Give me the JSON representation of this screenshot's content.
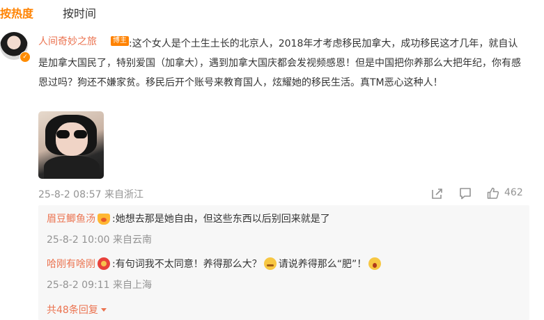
{
  "tabs": {
    "hot": "按热度",
    "time": "按时间"
  },
  "comment": {
    "author": "人间奇妙之旅",
    "tag": "博主",
    "text": ":这个女人是个土生土长的北京人，2018年才考虑移民加拿大，成功移民这才几年，就自认是加拿大国民了，特别爱国（加拿大），遇到加拿大国庆都会发视频感恩！但是中国把你养那么大把年纪，你有感恩过吗？狗还不嫌家贫。移民后开个账号来教育国人，炫耀她的移民生活。真TM恶心这种人！",
    "meta": "25-8-2 08:57 来自浙江",
    "likes": "462"
  },
  "replies": [
    {
      "name": "眉豆鲫鱼汤",
      "text": ":她想去那是她自由，但这些东西以后别回来就是了",
      "meta": "25-8-2 10:00 来自云南"
    },
    {
      "name": "哈刚有啥刚",
      "text_a": ":有句词我不太同意！养得那么大？",
      "text_b": "请说养得那么“肥”！",
      "meta": "25-8-2 09:11 来自上海"
    }
  ],
  "more_replies": "共48条回复",
  "icons": {
    "share": "share-icon",
    "comment": "comment-icon",
    "like": "like-icon"
  },
  "colors": {
    "accent": "#ff8200",
    "link": "#eb7350",
    "meta": "#939393"
  }
}
